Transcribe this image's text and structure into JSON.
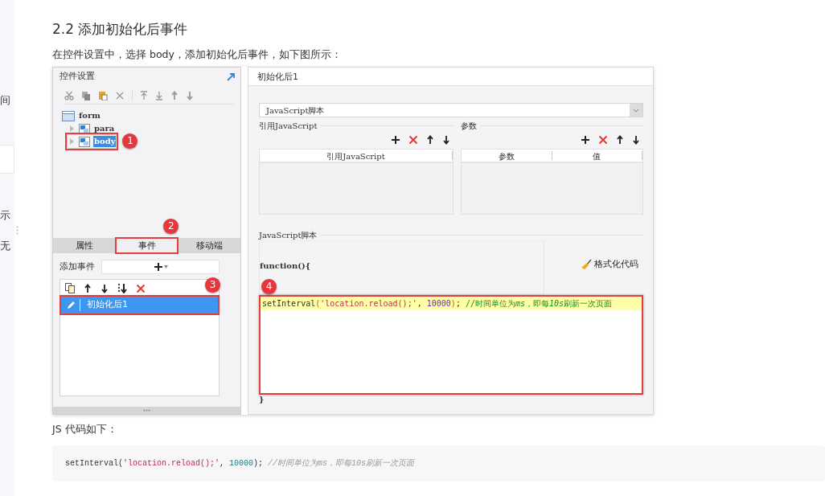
{
  "sidebar_fragments": [
    "间",
    "示",
    "无"
  ],
  "heading": "2.2 添加初始化后事件",
  "intro": "在控件设置中，选择 body，添加初始化后事件，如下图所示：",
  "settings_panel": {
    "title": "控件设置",
    "tree": [
      {
        "label": "form",
        "children": [
          {
            "label": "para",
            "expanded": false,
            "selected": false
          },
          {
            "label": "body",
            "expanded": false,
            "selected": true,
            "callout": "1"
          }
        ]
      }
    ],
    "tabs": [
      {
        "label": "属性",
        "selected": false
      },
      {
        "label": "事件",
        "selected": true,
        "callout": "2"
      },
      {
        "label": "移动端",
        "selected": false
      }
    ],
    "add_event_label": "添加事件",
    "events": [
      {
        "label": "初始化后1",
        "selected": true,
        "callout": "3"
      }
    ]
  },
  "event_editor": {
    "title": "初始化后1",
    "script_type": "JavaScript脚本",
    "reference_section": {
      "title": "引用JavaScript",
      "columns": [
        "引用JavaScript"
      ]
    },
    "params_section": {
      "title": "参数",
      "columns": [
        "参数",
        "值"
      ]
    },
    "script_section": {
      "title": "JavaScript脚本",
      "header": "function(){",
      "format_button": "格式化代码",
      "callout": "4",
      "footer": "}",
      "code": [
        {
          "kind": "plain",
          "text": "setInterval"
        },
        {
          "kind": "paren",
          "text": "("
        },
        {
          "kind": "string",
          "text": "'location.reload();'"
        },
        {
          "kind": "plain",
          "text": ", "
        },
        {
          "kind": "number",
          "text": "10000"
        },
        {
          "kind": "paren",
          "text": ")"
        },
        {
          "kind": "plain",
          "text": "; "
        },
        {
          "kind": "comment",
          "text": "//时间单位为"
        },
        {
          "kind": "comment_em",
          "text": "ms"
        },
        {
          "kind": "comment",
          "text": "，即每"
        },
        {
          "kind": "comment_em",
          "text": "10s"
        },
        {
          "kind": "comment",
          "text": "刷新一次页面"
        }
      ]
    }
  },
  "code_caption": "JS 代码如下：",
  "code_block": [
    {
      "kind": "plain",
      "text": "setInterval("
    },
    {
      "kind": "string",
      "text": "'location.reload();'"
    },
    {
      "kind": "plain",
      "text": ",  "
    },
    {
      "kind": "number",
      "text": "10000"
    },
    {
      "kind": "plain",
      "text": ");  "
    },
    {
      "kind": "comment",
      "text": "//时间单位为ms，即每10s刷新一次页面"
    }
  ]
}
